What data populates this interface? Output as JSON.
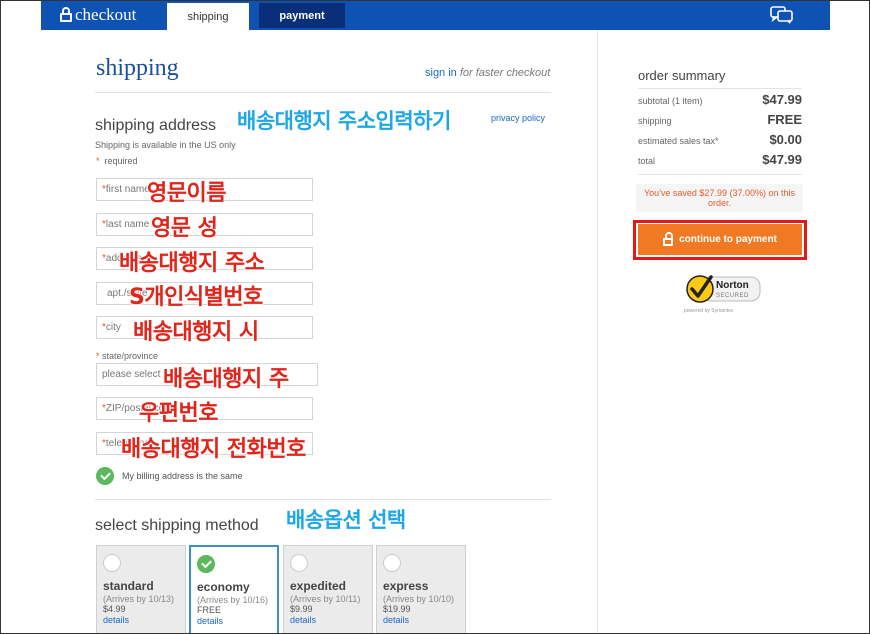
{
  "topbar": {
    "logo_text": "checkout",
    "tabs": [
      {
        "label": "shipping",
        "active": true
      },
      {
        "label": "payment",
        "active": false
      }
    ],
    "brand_color": "#0e52b3",
    "icons": [
      "lock-icon",
      "chat-icon"
    ]
  },
  "shipping": {
    "title": "shipping",
    "signin_link": "sign in",
    "signin_suffix": "for faster checkout",
    "address_heading": "shipping address",
    "privacy_link": "privacy policy",
    "us_only_note": "Shipping is available in the US only",
    "required_note": "required",
    "fields": {
      "first_name": "first name",
      "last_name": "last name",
      "address": "address",
      "apt": "apt./suite",
      "city": "city",
      "state_label": "state/province",
      "state_select": "please select",
      "zip": "ZIP/postal code",
      "telephone": "telephone"
    },
    "billing_same": "My billing address is the same",
    "method_heading": "select shipping method",
    "options": [
      {
        "name": "standard",
        "arrives": "(Arrives by 10/13)",
        "price": "$4.99",
        "details": "details",
        "selected": false
      },
      {
        "name": "economy",
        "arrives": "(Arrives by 10/16)",
        "price": "FREE",
        "details": "details",
        "selected": true
      },
      {
        "name": "expedited",
        "arrives": "(Arrives by 10/11)",
        "price": "$9.99",
        "details": "details",
        "selected": false
      },
      {
        "name": "express",
        "arrives": "(Arrives by 10/10)",
        "price": "$19.99",
        "details": "details",
        "selected": false
      }
    ]
  },
  "annotations": {
    "address_input": "배송대행지 주소입력하기",
    "first_name": "영문이름",
    "last_name": "영문 성",
    "address": "배송대행지 주소",
    "apt": "S개인식별번호",
    "city": "배송대행지 시",
    "state": "배송대행지 주",
    "zip": "우편번호",
    "telephone": "배송대행지 전화번호",
    "shipping_option": "배송옵션 선택"
  },
  "summary": {
    "title": "order summary",
    "rows": [
      {
        "label": "subtotal (1 item)",
        "value": "$47.99"
      },
      {
        "label": "shipping",
        "value": "FREE"
      },
      {
        "label": "estimated sales tax*",
        "value": "$0.00"
      },
      {
        "label": "total",
        "value": "$47.99"
      }
    ],
    "saved_note": "You've saved $27.99 (37.00%) on this order.",
    "pay_button": "continue to payment",
    "badge": {
      "title": "Norton",
      "sub": "SECURED",
      "powered": "powered by Symantec"
    },
    "accent_color": "#f07a24"
  }
}
